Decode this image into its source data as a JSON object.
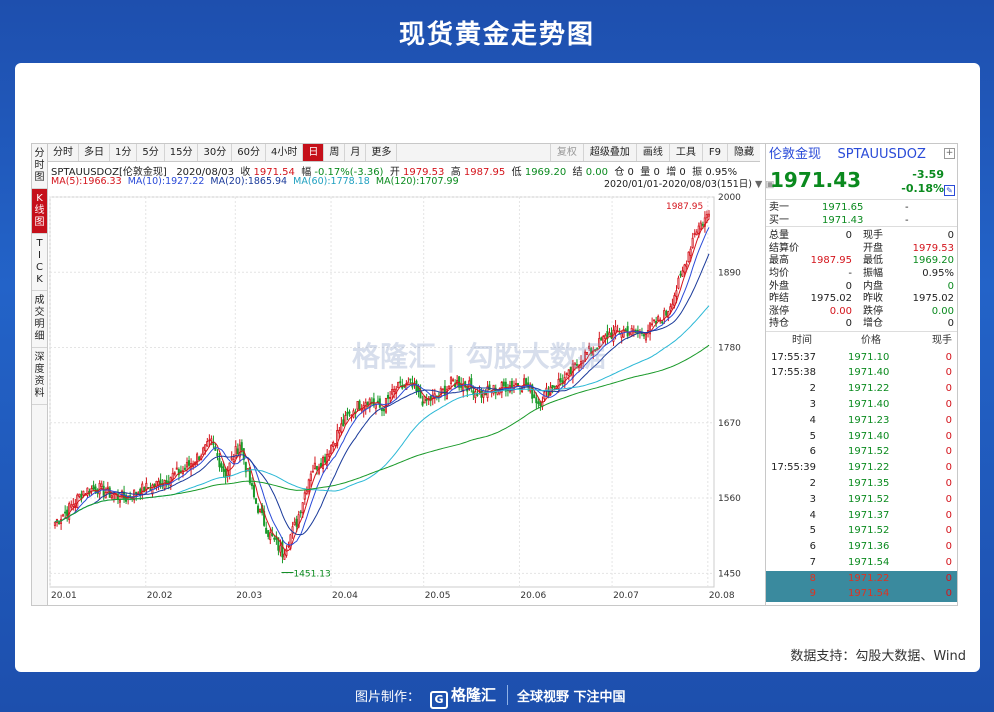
{
  "page_title": "现货黄金走势图",
  "source_note": "数据支持：勾股大数据、Wind",
  "footer": {
    "made_by": "图片制作：",
    "logo_text": "格隆汇",
    "slogan": "全球视野 下注中国"
  },
  "watermark": "格隆汇 | 勾股大数据",
  "period_tabs": [
    "分时",
    "多日",
    "1分",
    "5分",
    "15分",
    "30分",
    "60分",
    "4小时",
    "日",
    "周",
    "月",
    "更多"
  ],
  "active_tab": "日",
  "tools": [
    "复权",
    "超级叠加",
    "画线",
    "工具",
    "F9",
    "隐藏"
  ],
  "side_tabs": [
    "分时图",
    "K线图",
    "TICK",
    "成交明细",
    "深度资料"
  ],
  "info_line": {
    "symbol": "SPTAUUSDOZ[伦敦金现]",
    "date": "2020/08/03",
    "close_label": "收",
    "close": "1971.54",
    "amp_label": "幅",
    "amp": "-0.17%(-3.36)",
    "open_label": "开",
    "open": "1979.53",
    "high_label": "高",
    "high": "1987.95",
    "low_label": "低",
    "low": "1969.20",
    "settle_label": "结",
    "settle": "0.00",
    "oi_label": "仓",
    "oi": "0",
    "vol_label": "量",
    "vol": "0",
    "inc_label": "增",
    "inc": "0",
    "swing_label": "振",
    "swing": "0.95%"
  },
  "ma_line": {
    "ma5": "MA(5):1966.33",
    "ma10": "MA(10):1927.22",
    "ma20": "MA(20):1865.94",
    "ma60": "MA(60):1778.18",
    "ma120": "MA(120):1707.99"
  },
  "date_range": "2020/01/01-2020/08/03(151日)",
  "chart_data": {
    "type": "candlestick",
    "ylim": [
      1430,
      2000
    ],
    "y_ticks": [
      "2000",
      "1890",
      "1780",
      "1670",
      "1560",
      "1450"
    ],
    "x_ticks": [
      "20.01",
      "20.02",
      "20.03",
      "20.04",
      "20.05",
      "20.06",
      "20.07",
      "20.08"
    ],
    "max_label": "1987.95",
    "min_label": "1451.13",
    "colors": {
      "up": "#d4141c",
      "down": "#1a9a2a",
      "ma5": "#d4141c",
      "ma10": "#2a4bd8",
      "ma20": "#1a3a9a",
      "ma60": "#2bb8d6",
      "ma120": "#1a9a2a"
    },
    "weekly_closes": [
      1525,
      1545,
      1570,
      1575,
      1565,
      1560,
      1572,
      1578,
      1590,
      1600,
      1620,
      1640,
      1595,
      1640,
      1560,
      1510,
      1480,
      1525,
      1600,
      1620,
      1660,
      1690,
      1705,
      1690,
      1720,
      1725,
      1700,
      1710,
      1730,
      1725,
      1712,
      1720,
      1725,
      1730,
      1700,
      1725,
      1735,
      1765,
      1780,
      1800,
      1805,
      1800,
      1810,
      1830,
      1880,
      1950,
      1975
    ]
  },
  "quote_panel": {
    "name": "伦敦金现",
    "code": "SPTAUUSDOZ",
    "last": "1971.43",
    "change": "-3.59",
    "change_pct": "-0.18%",
    "ask_label": "卖一",
    "ask": "1971.65",
    "ask_vol": "-",
    "bid_label": "买一",
    "bid": "1971.43",
    "bid_vol": "-",
    "stats": [
      [
        "总量",
        "0",
        "现手",
        "0"
      ],
      [
        "结算价",
        "",
        "开盘",
        "1979.53"
      ],
      [
        "最高",
        "1987.95",
        "最低",
        "1969.20"
      ],
      [
        "均价",
        "-",
        "振幅",
        "0.95%"
      ],
      [
        "外盘",
        "0",
        "内盘",
        "0"
      ],
      [
        "昨结",
        "1975.02",
        "昨收",
        "1975.02"
      ],
      [
        "涨停",
        "0.00",
        "跌停",
        "0.00"
      ],
      [
        "持仓",
        "0",
        "增仓",
        "0"
      ]
    ],
    "ticks_header": [
      "时间",
      "价格",
      "现手"
    ],
    "ticks": [
      [
        "17:55:37",
        "1971.10",
        "0"
      ],
      [
        "17:55:38",
        "1971.40",
        "0"
      ],
      [
        "2",
        "1971.22",
        "0"
      ],
      [
        "3",
        "1971.40",
        "0"
      ],
      [
        "4",
        "1971.23",
        "0"
      ],
      [
        "5",
        "1971.40",
        "0"
      ],
      [
        "6",
        "1971.52",
        "0"
      ],
      [
        "17:55:39",
        "1971.22",
        "0"
      ],
      [
        "2",
        "1971.35",
        "0"
      ],
      [
        "3",
        "1971.52",
        "0"
      ],
      [
        "4",
        "1971.37",
        "0"
      ],
      [
        "5",
        "1971.52",
        "0"
      ],
      [
        "6",
        "1971.36",
        "0"
      ],
      [
        "7",
        "1971.54",
        "0"
      ],
      [
        "8",
        "1971.22",
        "0"
      ],
      [
        "9",
        "1971.54",
        "0"
      ]
    ]
  }
}
